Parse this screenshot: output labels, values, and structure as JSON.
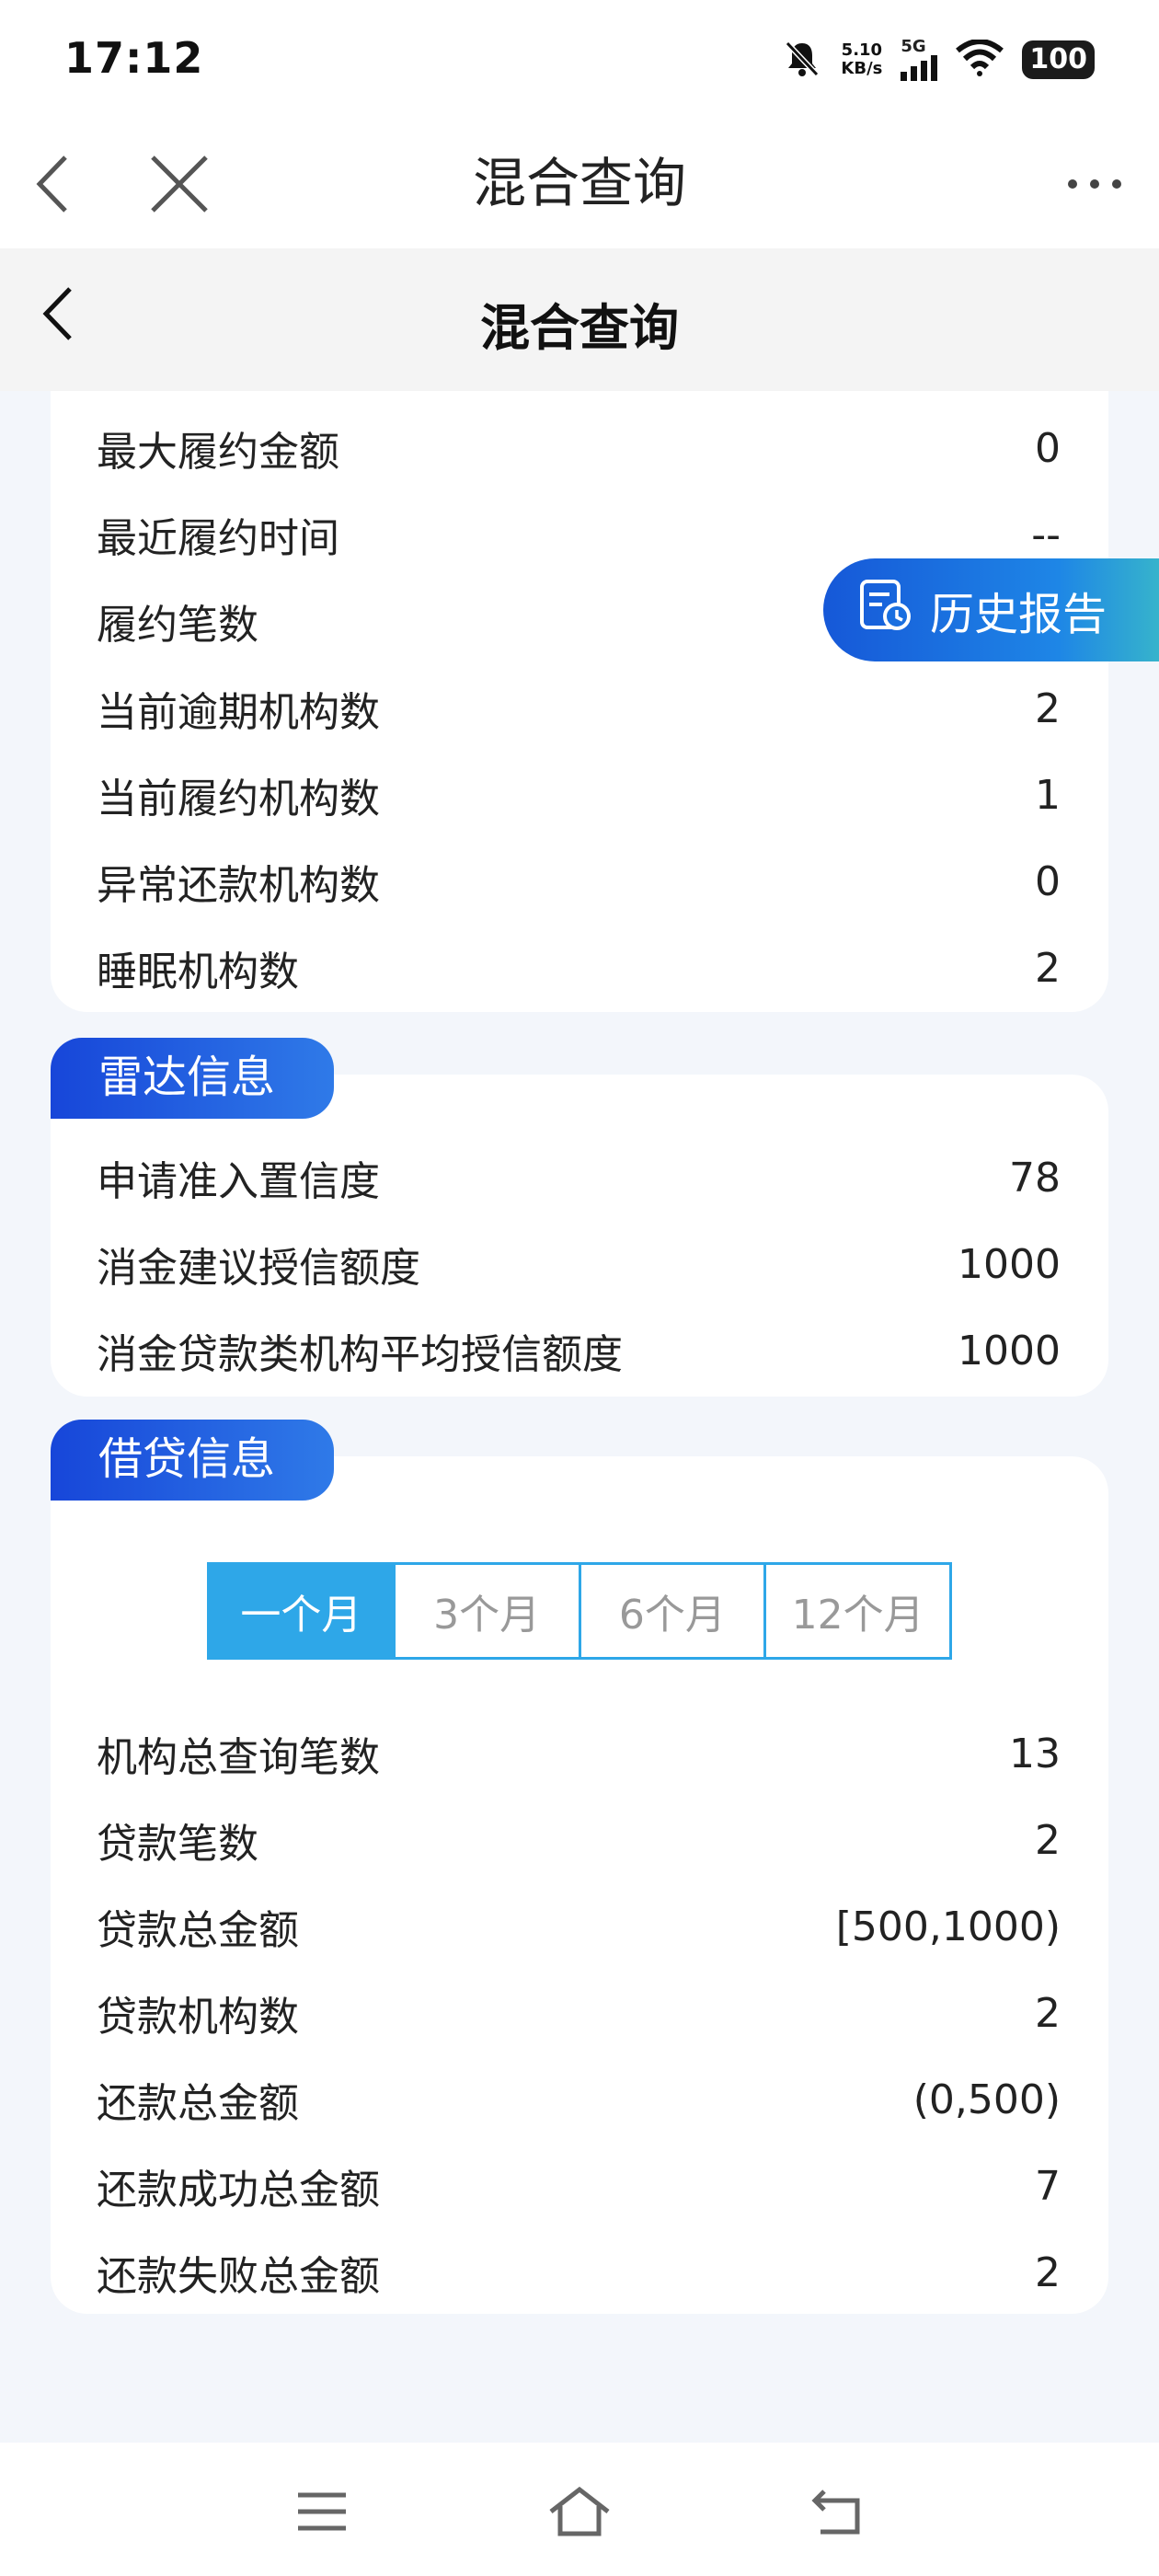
{
  "status_bar": {
    "time": "17:12",
    "speed_value": "5.10",
    "speed_unit": "KB/s",
    "network": "5G",
    "battery": "100",
    "icons": [
      "bell-off-icon",
      "signal-icon",
      "wifi-icon",
      "battery-icon"
    ]
  },
  "browser_header": {
    "title": "混合查询",
    "icons": [
      "back-icon",
      "close-icon",
      "more-icon"
    ]
  },
  "page_header": {
    "title": "混合查询",
    "icons": [
      "back-icon"
    ]
  },
  "floating_button": {
    "label": "历史报告",
    "icon": "report-clock-icon"
  },
  "performance_card": {
    "rows": [
      {
        "label": "最大履约金额",
        "value": "0"
      },
      {
        "label": "最近履约时间",
        "value": "--"
      },
      {
        "label": "履约笔数",
        "value": ""
      },
      {
        "label": "当前逾期机构数",
        "value": "2"
      },
      {
        "label": "当前履约机构数",
        "value": "1"
      },
      {
        "label": "异常还款机构数",
        "value": "0"
      },
      {
        "label": "睡眠机构数",
        "value": "2"
      }
    ]
  },
  "radar_card": {
    "tag": "雷达信息",
    "rows": [
      {
        "label": "申请准入置信度",
        "value": "78"
      },
      {
        "label": "消金建议授信额度",
        "value": "1000"
      },
      {
        "label": "消金贷款类机构平均授信额度",
        "value": "1000"
      }
    ]
  },
  "loan_card": {
    "tag": "借贷信息",
    "tabs": [
      {
        "label": "一个月",
        "active": true
      },
      {
        "label": "3个月",
        "active": false
      },
      {
        "label": "6个月",
        "active": false
      },
      {
        "label": "12个月",
        "active": false
      }
    ],
    "rows": [
      {
        "label": "机构总查询笔数",
        "value": "13"
      },
      {
        "label": "贷款笔数",
        "value": "2"
      },
      {
        "label": "贷款总金额",
        "value": "[500,1000)"
      },
      {
        "label": "贷款机构数",
        "value": "2"
      },
      {
        "label": "还款总金额",
        "value": "(0,500)"
      },
      {
        "label": "还款成功总金额",
        "value": "7"
      },
      {
        "label": "还款失败总金额",
        "value": "2"
      }
    ]
  },
  "bottom_nav": {
    "icons": [
      "menu-icon",
      "home-icon",
      "return-icon"
    ]
  },
  "colors": {
    "accent": "#2ea7e8",
    "tag_gradient_start": "#1746d9",
    "tag_gradient_end": "#2f7ae8",
    "page_background": "#f3f6fb"
  }
}
